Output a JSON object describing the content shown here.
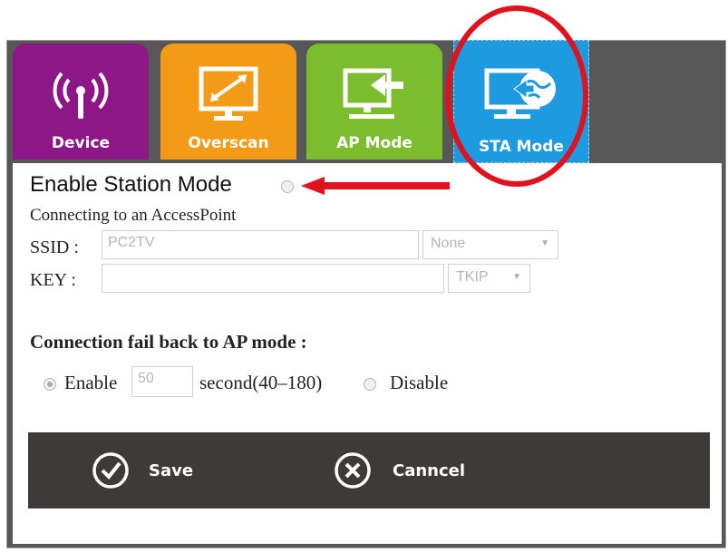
{
  "tabs": [
    {
      "label": "Device",
      "icon": "wifi-tower-icon",
      "color": "#8d1787"
    },
    {
      "label": "Overscan",
      "icon": "monitor-resize-icon",
      "color": "#f39a17"
    },
    {
      "label": "AP Mode",
      "icon": "monitor-arrow-icon",
      "color": "#7bbd2f"
    },
    {
      "label": "STA Mode",
      "icon": "monitor-globe-icon",
      "color": "#1e9ae0",
      "selected": true
    }
  ],
  "station": {
    "title": "Enable Station Mode",
    "subtitle": "Connecting to an AccessPoint",
    "ssid_label": "SSID :",
    "ssid_value": "PC2TV",
    "security_value": "None",
    "key_label": "KEY :",
    "key_value": "",
    "cipher_value": "TKIP"
  },
  "fallback": {
    "title": "Connection fail back to AP mode :",
    "enable_label": "Enable",
    "seconds_value": "50",
    "seconds_hint": "second(40–180)",
    "disable_label": "Disable"
  },
  "actions": {
    "save_label": "Save",
    "cancel_label": "Canncel"
  },
  "colors": {
    "annotation_red": "#e0121e",
    "action_bar": "#3d3b39"
  }
}
